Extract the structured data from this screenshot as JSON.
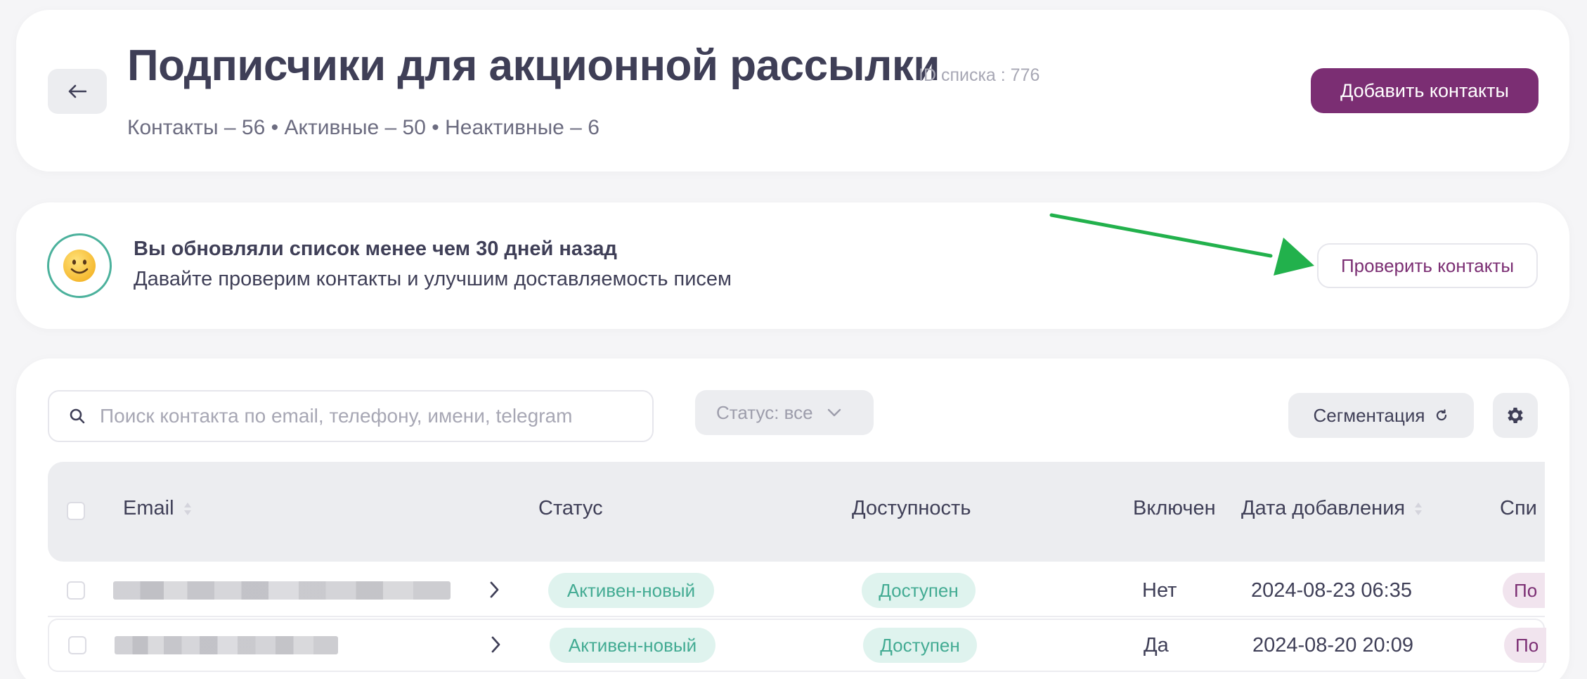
{
  "header": {
    "title": "Подписчики для акционной рассылки",
    "list_id": "ID списка : 776",
    "counters": "Контакты – 56 • Активные – 50 • Неактивные – 6",
    "add_contacts_label": "Добавить контакты"
  },
  "notice": {
    "title": "Вы обновляли список менее чем 30 дней назад",
    "text": "Давайте проверим контакты и улучшим доставляемость писем",
    "check_contacts_label": "Проверить контакты"
  },
  "toolbar": {
    "search_placeholder": "Поиск контакта по email, телефону, имени, telegram",
    "status_filter_label": "Статус: все",
    "segmentation_label": "Сегментация"
  },
  "table": {
    "columns": [
      "Email",
      "Статус",
      "Доступность",
      "Включен",
      "Дата добавления",
      "Спи"
    ],
    "rows": [
      {
        "status": "Активен-новый",
        "availability": "Доступен",
        "enabled": "Нет",
        "date_added": "2024-08-23 06:35",
        "list": "По"
      },
      {
        "status": "Активен-новый",
        "availability": "Доступен",
        "enabled": "Да",
        "date_added": "2024-08-20 20:09",
        "list": "По"
      }
    ]
  },
  "colors": {
    "brand": "#7b2e73",
    "status_green": "#43ab93",
    "status_green_bg": "#dff3ee",
    "arrow_green": "#22b14c"
  },
  "icons": {
    "back": "arrow-left-icon",
    "notice": "smiling-face-icon",
    "search": "search-icon",
    "filter": "chevron-down-icon",
    "segmentation": "refresh-icon",
    "settings": "gear-icon",
    "sort": "sort-icon",
    "row_expand": "chevron-right-icon"
  }
}
